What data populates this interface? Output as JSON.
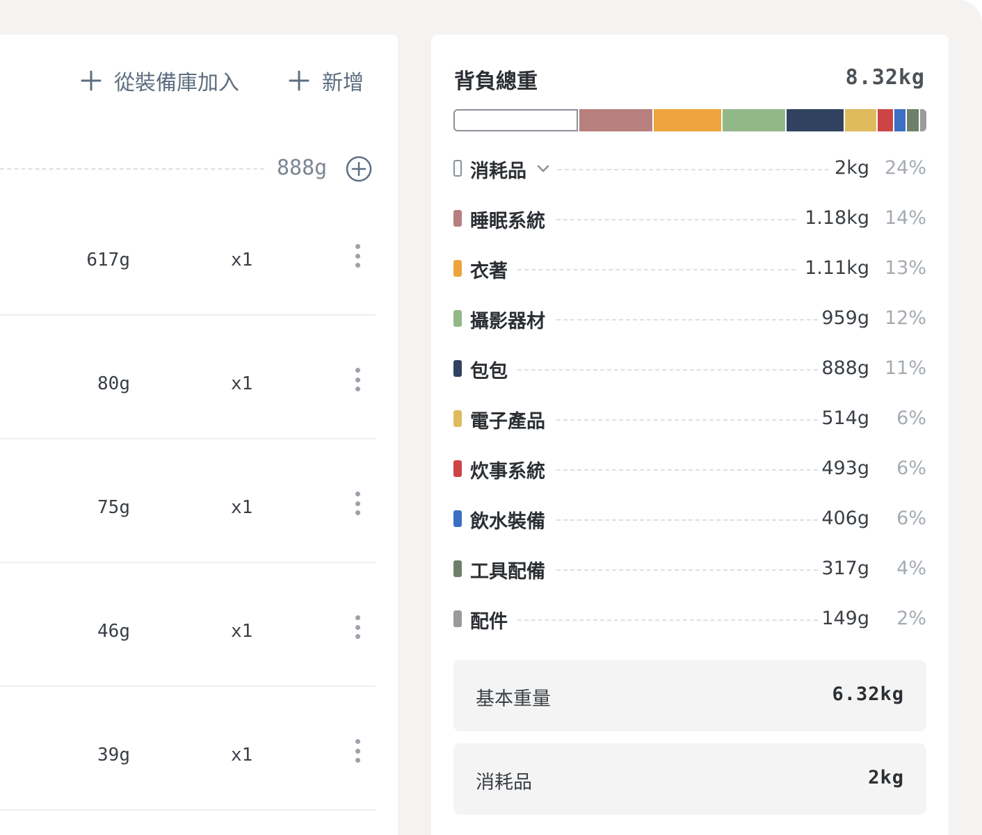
{
  "toolbar": {
    "import_label": "從裝備庫加入",
    "add_label": "新增"
  },
  "group": {
    "total": "888g"
  },
  "items": [
    {
      "weight": "617g",
      "qty": "x1"
    },
    {
      "weight": "80g",
      "qty": "x1"
    },
    {
      "weight": "75g",
      "qty": "x1"
    },
    {
      "weight": "46g",
      "qty": "x1"
    },
    {
      "weight": "39g",
      "qty": "x1"
    }
  ],
  "summary": {
    "title": "背負總重",
    "total": "8.32kg",
    "categories": [
      {
        "name": "消耗品",
        "weight": "2kg",
        "percent": "24%",
        "color": "#ffffff",
        "outline": true,
        "expandable": true,
        "share": 24
      },
      {
        "name": "睡眠系統",
        "weight": "1.18kg",
        "percent": "14%",
        "color": "#b77f7d",
        "share": 14
      },
      {
        "name": "衣著",
        "weight": "1.11kg",
        "percent": "13%",
        "color": "#eda43c",
        "share": 13
      },
      {
        "name": "攝影器材",
        "weight": "959g",
        "percent": "12%",
        "color": "#93b888",
        "share": 12
      },
      {
        "name": "包包",
        "weight": "888g",
        "percent": "11%",
        "color": "#30425f",
        "share": 11
      },
      {
        "name": "電子產品",
        "weight": "514g",
        "percent": "6%",
        "color": "#dfbb5d",
        "share": 6
      },
      {
        "name": "炊事系統",
        "weight": "493g",
        "percent": "6%",
        "color": "#cc4444",
        "share": 3
      },
      {
        "name": "飲水裝備",
        "weight": "406g",
        "percent": "6%",
        "color": "#3a6fc4",
        "share": 2.2
      },
      {
        "name": "工具配備",
        "weight": "317g",
        "percent": "4%",
        "color": "#6f7f6a",
        "share": 2.2
      },
      {
        "name": "配件",
        "weight": "149g",
        "percent": "2%",
        "color": "#9a9a9a",
        "share": 1.2
      }
    ],
    "base_weight_label": "基本重量",
    "base_weight_value": "6.32kg",
    "consumables_label": "消耗品",
    "consumables_value": "2kg"
  }
}
